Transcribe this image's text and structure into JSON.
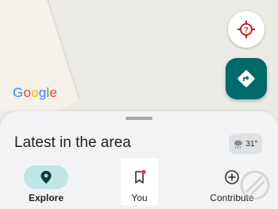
{
  "map": {
    "logo_text": "Google",
    "logo_letters": [
      {
        "char": "G",
        "color": "#4285f4"
      },
      {
        "char": "o",
        "color": "#ea4335"
      },
      {
        "char": "o",
        "color": "#fbbc05"
      },
      {
        "char": "g",
        "color": "#4285f4"
      },
      {
        "char": "l",
        "color": "#34a853"
      },
      {
        "char": "e",
        "color": "#ea4335"
      }
    ]
  },
  "buttons": {
    "location_icon": "location-target-icon",
    "directions_icon": "directions-arrow-icon"
  },
  "sheet": {
    "title": "Latest in the area",
    "weather": {
      "icon": "cloud-rain-icon",
      "temperature": "31°"
    }
  },
  "nav": {
    "items": [
      {
        "label": "Explore",
        "icon": "pin-icon",
        "selected": true
      },
      {
        "label": "You",
        "icon": "bookmark-icon",
        "has_notification": true
      },
      {
        "label": "Contribute",
        "icon": "add-circle-icon"
      }
    ]
  },
  "colors": {
    "accent": "#006a6a",
    "explore_pill": "#bfe5e5",
    "notification_dot": "#e53935",
    "location_icon": "#c5221f"
  }
}
